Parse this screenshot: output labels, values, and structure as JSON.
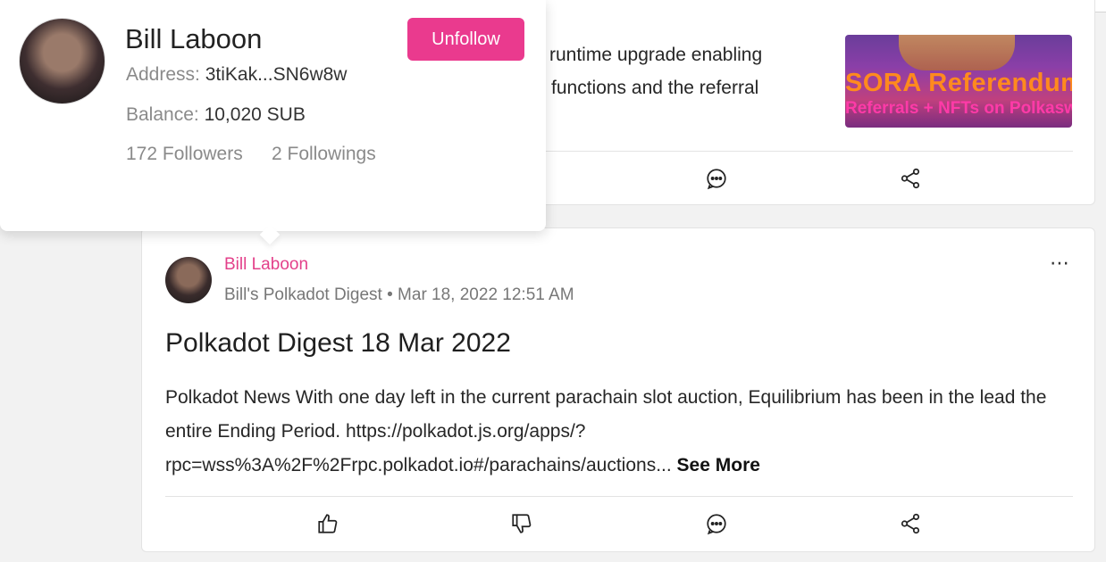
{
  "top_post": {
    "text_line1": "runtime upgrade enabling",
    "text_line2": "functions and the referral",
    "thumbnail_title": "SORA Referendum",
    "thumbnail_subtitle": "Referrals + NFTs on Polkaswap"
  },
  "main_post": {
    "author": "Bill Laboon",
    "space": "Bill's Polkadot Digest",
    "separator": "•",
    "date": "Mar 18, 2022 12:51 AM",
    "more_label": "⋯",
    "title": "Polkadot Digest 18 Mar 2022",
    "body": "Polkadot News With one day left in the current parachain slot auction, Equilibrium has been in the lead the entire Ending Period. https://polkadot.js.org/apps/?rpc=wss%3A%2F%2Frpc.polkadot.io#/parachains/auctions...",
    "see_more": "See More"
  },
  "profile_popover": {
    "name": "Bill Laboon",
    "address_label": "Address:",
    "address_value": "3tiKak...SN6w8w",
    "balance_label": "Balance:",
    "balance_value": "10,020 SUB",
    "followers": "172 Followers",
    "following": "2 Followings",
    "unfollow_label": "Unfollow"
  },
  "icons": {
    "like": "thumbs-up-icon",
    "dislike": "thumbs-down-icon",
    "comment": "comment-icon",
    "share": "share-icon"
  },
  "colors": {
    "accent": "#ea3a8e",
    "author_link": "#e3408a"
  }
}
